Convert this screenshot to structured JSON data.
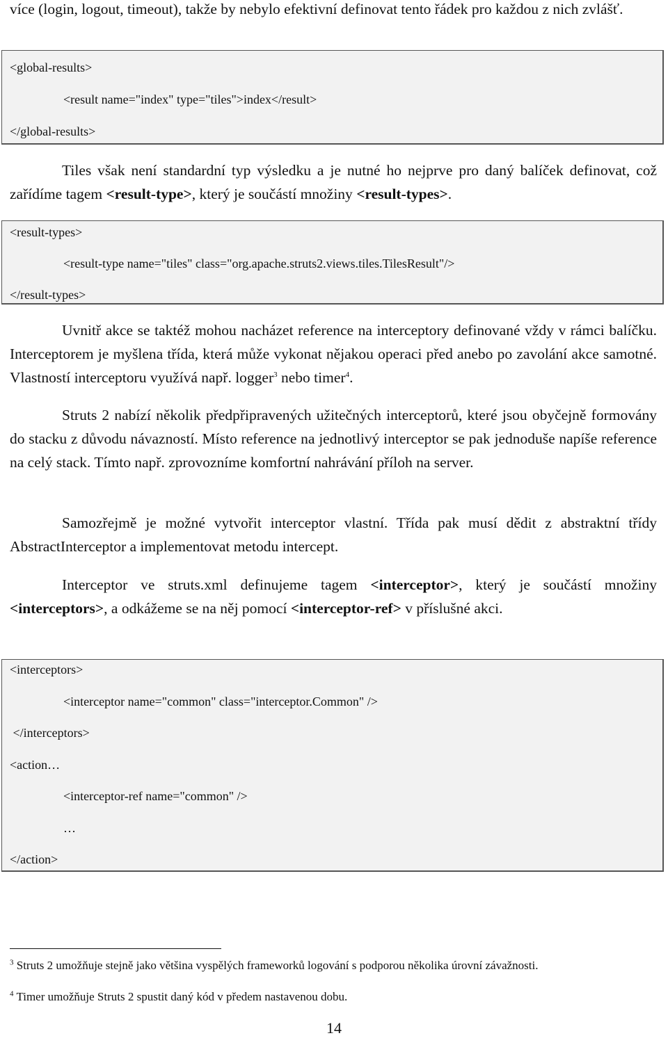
{
  "paragraphs": {
    "p0": "více (login, logout, timeout), takže by nebylo efektivní definovat tento řádek pro každou z nich zvlášť.",
    "p1_a": "Tiles však není standardní typ výsledku a je nutné ho nejprve pro daný balíček definovat, což zařídíme tagem ",
    "p1_b1": "<result-type>",
    "p1_c": ", který je součástí množiny ",
    "p1_b2": "<result-types>",
    "p1_d": ".",
    "p2_a": "Uvnitř akce se taktéž mohou nacházet reference na interceptory definované vždy v rámci balíčku. Interceptorem je myšlena třída, která může vykonat nějakou operaci před anebo po zavolání akce samotné. Vlastností interceptoru využívá např. logger",
    "p2_sup1": "3",
    "p2_b": " nebo timer",
    "p2_sup2": "4",
    "p2_c": ".",
    "p3": "Struts 2 nabízí několik předpřipravených užitečných interceptorů, které jsou obyčejně formovány do stacku z důvodu návazností. Místo reference na jednotlivý interceptor se pak jednoduše napíše reference na celý stack. Tímto např. zprovozníme komfortní nahrávání příloh na server.",
    "p4": "Samozřejmě je možné vytvořit interceptor vlastní. Třída pak musí dědit z abstraktní třídy AbstractInterceptor a implementovat metodu intercept.",
    "p5_a": "Interceptor ve struts.xml definujeme tagem ",
    "p5_b1": "<interceptor>",
    "p5_c": ", který je součástí množiny ",
    "p5_b2": "<interceptors>",
    "p5_d": ",  a odkážeme se na něj pomocí ",
    "p5_b3": "<interceptor-ref>",
    "p5_e": " v příslušné akci."
  },
  "code_blocks": {
    "global_results": [
      "<global-results>",
      "<result name=\"index\" type=\"tiles\">index</result>",
      "</global-results>"
    ],
    "result_types": [
      "<result-types>",
      "<result-type name=\"tiles\" class=\"org.apache.struts2.views.tiles.TilesResult\"/>",
      "</result-types>"
    ],
    "interceptors": [
      "<interceptors>",
      "<interceptor name=\"common\" class=\"interceptor.Common\" />",
      " </interceptors>",
      "<action…",
      "<interceptor-ref name=\"common\" />",
      "…",
      "</action>"
    ]
  },
  "footnotes": [
    {
      "num": "3",
      "text": " Struts 2 umožňuje stejně jako většina vyspělých frameworků logování s podporou několika úrovní závažnosti."
    },
    {
      "num": "4",
      "text": " Timer umožňuje Struts 2 spustit daný kód v předem nastavenou dobu."
    }
  ],
  "page_number": "14"
}
